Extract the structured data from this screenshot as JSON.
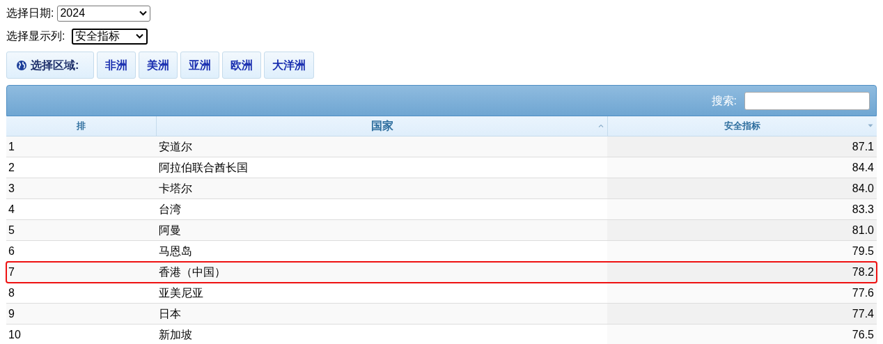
{
  "date_filter": {
    "label": "选择日期:",
    "value": "2024"
  },
  "column_filter": {
    "label": "选择显示列:",
    "value": "安全指标"
  },
  "region_bar": {
    "label": "选择区域:",
    "regions": [
      "非洲",
      "美洲",
      "亚洲",
      "欧洲",
      "大洋洲"
    ]
  },
  "search": {
    "label": "搜索:"
  },
  "table": {
    "columns": [
      {
        "label": "排",
        "kind": "plain"
      },
      {
        "label": "国家",
        "kind": "ascending"
      },
      {
        "label": "安全指标",
        "kind": "descending"
      }
    ],
    "rows": [
      {
        "rank": "1",
        "country": "安道尔",
        "value": "87.1",
        "highlighted": false
      },
      {
        "rank": "2",
        "country": "阿拉伯联合酋长国",
        "value": "84.4",
        "highlighted": false
      },
      {
        "rank": "3",
        "country": "卡塔尔",
        "value": "84.0",
        "highlighted": false
      },
      {
        "rank": "4",
        "country": "台湾",
        "value": "83.3",
        "highlighted": false
      },
      {
        "rank": "5",
        "country": "阿曼",
        "value": "81.0",
        "highlighted": false
      },
      {
        "rank": "6",
        "country": "马恩岛",
        "value": "79.5",
        "highlighted": false
      },
      {
        "rank": "7",
        "country": "香港（中国）",
        "value": "78.2",
        "highlighted": true
      },
      {
        "rank": "8",
        "country": "亚美尼亚",
        "value": "77.6",
        "highlighted": false
      },
      {
        "rank": "9",
        "country": "日本",
        "value": "77.4",
        "highlighted": false
      },
      {
        "rank": "10",
        "country": "新加坡",
        "value": "76.5",
        "highlighted": false
      }
    ]
  }
}
